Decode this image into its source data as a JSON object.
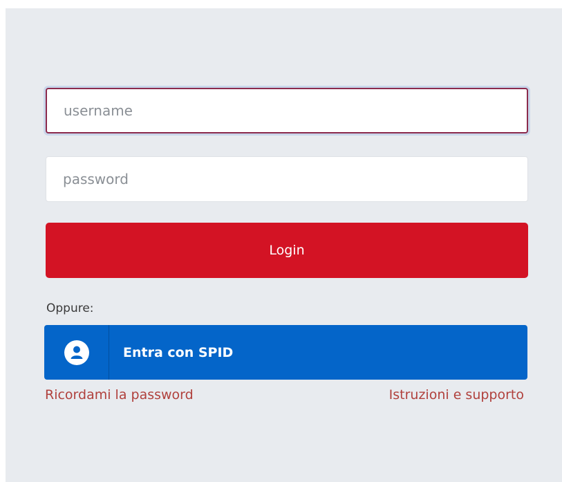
{
  "login_form": {
    "username_placeholder": "username",
    "username_value": "",
    "password_placeholder": "password",
    "password_value": "",
    "login_label": "Login",
    "or_label": "Oppure:",
    "spid_label": "Entra con SPID",
    "spid_icon": "user-icon",
    "remember_link": "Ricordami la password",
    "support_link": "Istruzioni e supporto"
  },
  "colors": {
    "login_button": "#d31324",
    "spid_button": "#0465c9",
    "link": "#b0403c",
    "background": "#e8ebef",
    "focus_border": "#8c2a4c"
  }
}
